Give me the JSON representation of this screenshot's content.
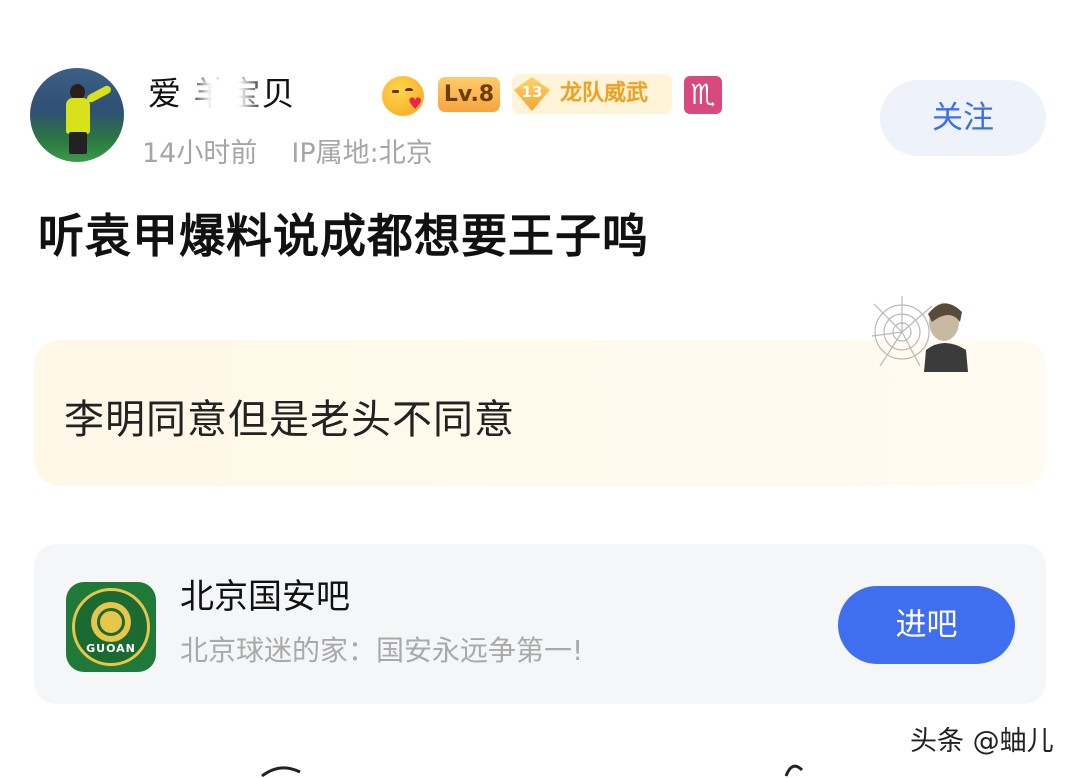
{
  "post": {
    "author": {
      "name": "爱   羊宝贝",
      "level": "Lv.8",
      "fan_badge": {
        "level": "13",
        "label": "龙队威武"
      },
      "zodiac": "♏"
    },
    "time": "14小时前",
    "ip_location": "IP属地:北京",
    "follow_label": "关注",
    "title": "听袁甲爆料说成都想要王子鸣",
    "content": "李明同意但是老头不同意"
  },
  "forum": {
    "name": "北京国安吧",
    "description": "北京球迷的家：国安永远争第一!",
    "enter_label": "进吧",
    "logo_text": "GUOAN"
  },
  "watermark": "头条 @蚰儿",
  "colors": {
    "accent_blue": "#3f6fee",
    "follow_bg": "#eef2fb",
    "content_bg": "#fff8e8",
    "forum_bg": "#f5f6f8"
  }
}
